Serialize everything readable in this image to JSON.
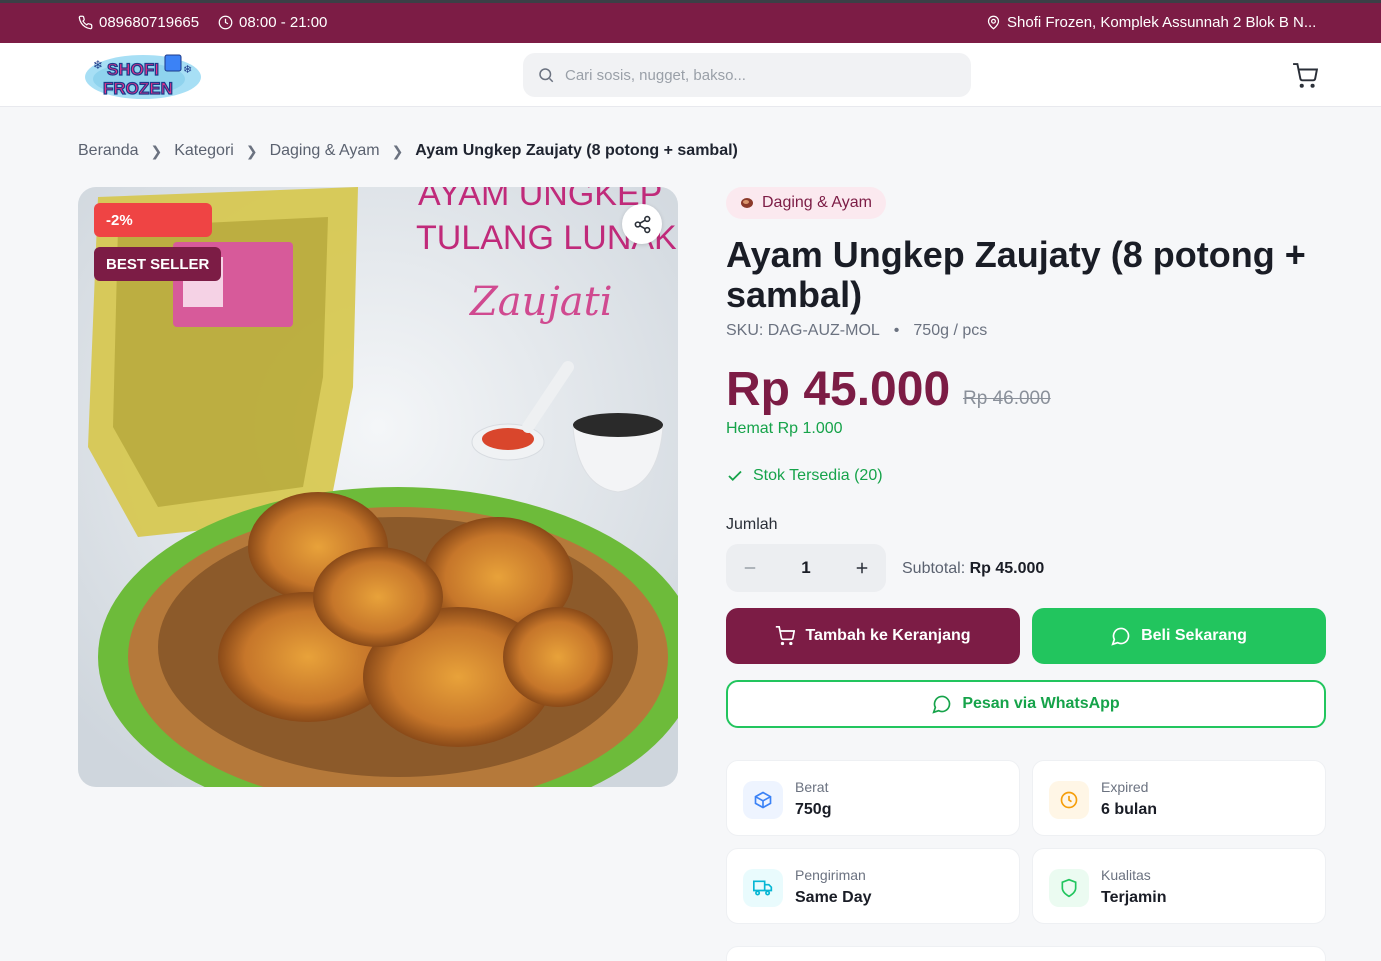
{
  "topbar": {
    "phone": "089680719665",
    "hours": "08:00 - 21:00",
    "address": "Shofi Frozen, Komplek Assunnah 2 Blok B N..."
  },
  "header": {
    "logo_text_1": "SHOFI",
    "logo_text_2": "FROZEN",
    "search_placeholder": "Cari sosis, nugget, bakso..."
  },
  "breadcrumb": {
    "items": [
      "Beranda",
      "Kategori",
      "Daging & Ayam"
    ],
    "current": "Ayam Ungkep Zaujaty (8 potong + sambal)"
  },
  "image": {
    "discount_badge": "-2%",
    "bestseller_badge": "BEST SELLER",
    "package_text_1": "AYAM UNGKEP",
    "package_text_2": "TULANG LUNAK",
    "package_brand": "Zaujati"
  },
  "product": {
    "category": "Daging & Ayam",
    "title": "Ayam Ungkep Zaujaty (8 potong + sambal)",
    "sku": "SKU: DAG-AUZ-MOL",
    "weight_unit": "750g / pcs",
    "price": "Rp 45.000",
    "old_price": "Rp 46.000",
    "savings": "Hemat Rp 1.000",
    "stock": "Stok Tersedia (20)",
    "qty_label": "Jumlah",
    "qty": "1",
    "subtotal_label": "Subtotal:",
    "subtotal_value": "Rp 45.000"
  },
  "actions": {
    "add_to_cart": "Tambah ke Keranjang",
    "buy_now": "Beli Sekarang",
    "whatsapp": "Pesan via WhatsApp"
  },
  "info_cards": [
    {
      "label": "Berat",
      "value": "750g",
      "icon": "box-icon",
      "color": "#3b82f6"
    },
    {
      "label": "Expired",
      "value": "6 bulan",
      "icon": "clock-icon",
      "color": "#f59e0b"
    },
    {
      "label": "Pengiriman",
      "value": "Same Day",
      "icon": "truck-icon",
      "color": "#06b6d4"
    },
    {
      "label": "Kualitas",
      "value": "Terjamin",
      "icon": "shield-icon",
      "color": "#22c55e"
    }
  ],
  "colors": {
    "brand": "#7c1c45",
    "green": "#22c55e",
    "discount": "#ef4444"
  }
}
